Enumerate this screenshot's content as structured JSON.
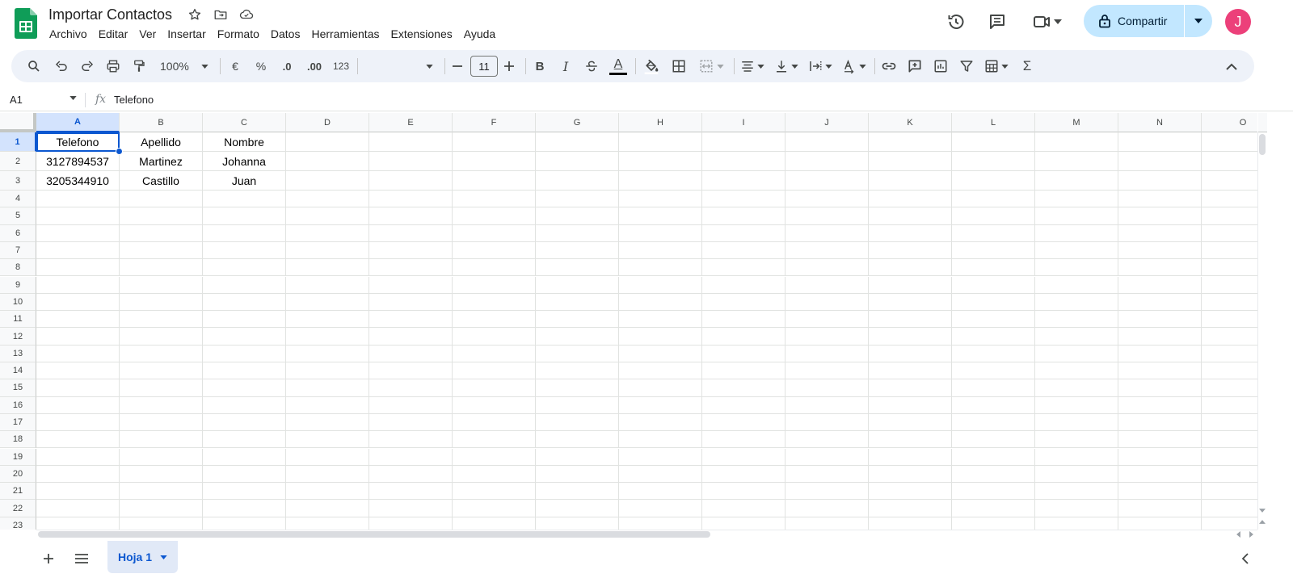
{
  "app": {
    "title": "Importar Contactos",
    "menu": [
      "Archivo",
      "Editar",
      "Ver",
      "Insertar",
      "Formato",
      "Datos",
      "Herramientas",
      "Extensiones",
      "Ayuda"
    ],
    "share_label": "Compartir",
    "avatar_initial": "J"
  },
  "toolbar": {
    "zoom": "100%",
    "currency": "€",
    "percent": "%",
    "decrease_decimals": ".0",
    "increase_decimals": ".00",
    "number_format": "123",
    "font_size": "11",
    "bold": "B",
    "italic": "I",
    "text_color_glyph": "A",
    "sum_glyph": "Σ"
  },
  "formula_bar": {
    "name_box": "A1",
    "fx": "fx",
    "content": "Telefono"
  },
  "grid": {
    "columns": [
      "A",
      "B",
      "C",
      "D",
      "E",
      "F",
      "G",
      "H",
      "I",
      "J",
      "K",
      "L",
      "M",
      "N",
      "O"
    ],
    "rows": [
      "1",
      "2",
      "3",
      "4",
      "5",
      "6",
      "7",
      "8",
      "9",
      "10",
      "11",
      "12",
      "13",
      "14",
      "15",
      "16",
      "17",
      "18",
      "19",
      "20",
      "21",
      "22",
      "23"
    ],
    "cells": [
      [
        "Telefono",
        "Apellido",
        "Nombre"
      ],
      [
        "3127894537",
        "Martinez",
        "Johanna"
      ],
      [
        "3205344910",
        "Castillo",
        "Juan"
      ]
    ],
    "selected_cell": "A1"
  },
  "sheets": {
    "tabs": [
      "Hoja 1"
    ],
    "active": "Hoja 1"
  },
  "colors": {
    "accent": "#0b57d0",
    "share_bg": "#c2e7ff",
    "toolbar_bg": "#eef2f9",
    "avatar_bg": "#ec407a",
    "sheets_green": "#0f9d58"
  }
}
